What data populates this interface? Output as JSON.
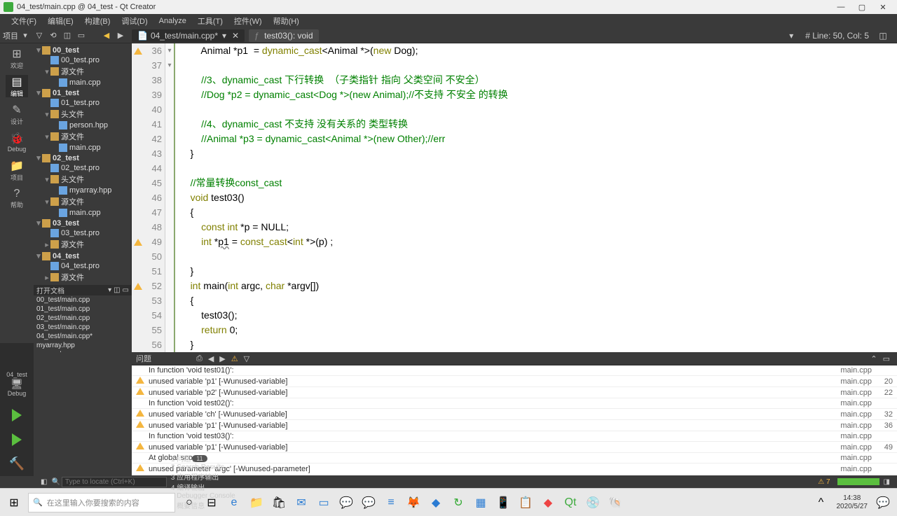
{
  "window": {
    "title": "04_test/main.cpp @ 04_test - Qt Creator"
  },
  "menu": [
    "文件(F)",
    "编辑(E)",
    "构建(B)",
    "调试(D)",
    "Analyze",
    "工具(T)",
    "控件(W)",
    "帮助(H)"
  ],
  "toolbar": {
    "project_label": "项目",
    "file_tab": "04_test/main.cpp*",
    "breadcrumb": "test03(): void",
    "cursor": "# Line: 50, Col: 5"
  },
  "sidebar": [
    {
      "label": "欢迎",
      "g": "⊞"
    },
    {
      "label": "编辑",
      "g": "▤",
      "active": true
    },
    {
      "label": "设计",
      "g": "✎"
    },
    {
      "label": "Debug",
      "g": "🐞"
    },
    {
      "label": "项目",
      "g": "📁"
    },
    {
      "label": "帮助",
      "g": "?"
    }
  ],
  "run": {
    "target": "04_test",
    "mode": "Debug"
  },
  "tree": [
    {
      "d": 0,
      "t": "00_test",
      "a": "▾",
      "f": "folder-ico",
      "b": true
    },
    {
      "d": 1,
      "t": "00_test.pro",
      "a": "",
      "f": "cpp-ico"
    },
    {
      "d": 1,
      "t": "源文件",
      "a": "▾",
      "f": "folder-ico"
    },
    {
      "d": 2,
      "t": "main.cpp",
      "a": "",
      "f": "cpp-ico"
    },
    {
      "d": 0,
      "t": "01_test",
      "a": "▾",
      "f": "folder-ico",
      "b": true
    },
    {
      "d": 1,
      "t": "01_test.pro",
      "a": "",
      "f": "cpp-ico"
    },
    {
      "d": 1,
      "t": "头文件",
      "a": "▾",
      "f": "folder-ico"
    },
    {
      "d": 2,
      "t": "person.hpp",
      "a": "",
      "f": "cpp-ico"
    },
    {
      "d": 1,
      "t": "源文件",
      "a": "▾",
      "f": "folder-ico"
    },
    {
      "d": 2,
      "t": "main.cpp",
      "a": "",
      "f": "cpp-ico"
    },
    {
      "d": 0,
      "t": "02_test",
      "a": "▾",
      "f": "folder-ico",
      "b": true
    },
    {
      "d": 1,
      "t": "02_test.pro",
      "a": "",
      "f": "cpp-ico"
    },
    {
      "d": 1,
      "t": "头文件",
      "a": "▾",
      "f": "folder-ico"
    },
    {
      "d": 2,
      "t": "myarray.hpp",
      "a": "",
      "f": "cpp-ico"
    },
    {
      "d": 1,
      "t": "源文件",
      "a": "▾",
      "f": "folder-ico"
    },
    {
      "d": 2,
      "t": "main.cpp",
      "a": "",
      "f": "cpp-ico"
    },
    {
      "d": 0,
      "t": "03_test",
      "a": "▾",
      "f": "folder-ico",
      "b": true
    },
    {
      "d": 1,
      "t": "03_test.pro",
      "a": "",
      "f": "cpp-ico"
    },
    {
      "d": 1,
      "t": "源文件",
      "a": "▸",
      "f": "folder-ico"
    },
    {
      "d": 0,
      "t": "04_test",
      "a": "▾",
      "f": "folder-ico",
      "b": true
    },
    {
      "d": 1,
      "t": "04_test.pro",
      "a": "",
      "f": "cpp-ico"
    },
    {
      "d": 1,
      "t": "源文件",
      "a": "▸",
      "f": "folder-ico"
    }
  ],
  "open_docs_header": "打开文档",
  "open_docs": [
    "00_test/main.cpp",
    "01_test/main.cpp",
    "02_test/main.cpp",
    "03_test/main.cpp",
    "04_test/main.cpp*",
    "myarray.hpp",
    "person.hpp"
  ],
  "code": {
    "first_line": 36,
    "lines": [
      {
        "n": 36,
        "warn": true,
        "html": "        Animal *p1  = <span class='kw'>dynamic_cast</span>&lt;Animal *&gt;(<span class='kw'>new</span> Dog);"
      },
      {
        "n": 37,
        "html": ""
      },
      {
        "n": 38,
        "html": "        <span class='comment'>//3、dynamic_cast 下行转换  （子类指针 指向 父类空间 不安全）</span>"
      },
      {
        "n": 39,
        "html": "        <span class='comment'>//Dog *p2 = dynamic_cast&lt;Dog *&gt;(new Animal);//不支持 不安全 的转换</span>"
      },
      {
        "n": 40,
        "html": ""
      },
      {
        "n": 41,
        "html": "        <span class='comment'>//4、dynamic_cast 不支持 没有关系的 类型转换</span>"
      },
      {
        "n": 42,
        "html": "        <span class='comment'>//Animal *p3 = dynamic_cast&lt;Animal *&gt;(new Other);//err</span>"
      },
      {
        "n": 43,
        "html": "    }"
      },
      {
        "n": 44,
        "html": ""
      },
      {
        "n": 45,
        "html": "    <span class='comment'>//常量转换const_cast</span>"
      },
      {
        "n": 46,
        "fold": "▾",
        "html": "    <span class='kw'>void</span> test03()"
      },
      {
        "n": 47,
        "html": "    {"
      },
      {
        "n": 48,
        "html": "        <span class='kw'>const</span> <span class='kw'>int</span> *p = NULL;"
      },
      {
        "n": 49,
        "warn": true,
        "html": "        <span class='kw'>int</span> *<span class='underline'>p1</span> = <span class='kw'>const_cast</span>&lt;<span class='kw'>int</span> *&gt;(p) ;"
      },
      {
        "n": 50,
        "html": "        "
      },
      {
        "n": 51,
        "html": "    }"
      },
      {
        "n": 52,
        "warn": true,
        "fold": "▾",
        "html": "    <span class='kw'>int</span> main(<span class='kw'>int</span> argc, <span class='kw'>char</span> *argv[])"
      },
      {
        "n": 53,
        "html": "    {"
      },
      {
        "n": 54,
        "html": "        test03();"
      },
      {
        "n": 55,
        "html": "        <span class='kw'>return</span> 0;"
      },
      {
        "n": 56,
        "html": "    }"
      }
    ]
  },
  "issues_header": "问题",
  "issues": [
    {
      "msg": "In function 'void test01()':",
      "file": "main.cpp",
      "line": ""
    },
    {
      "warn": true,
      "msg": "unused variable 'p1' [-Wunused-variable]",
      "file": "main.cpp",
      "line": "20"
    },
    {
      "warn": true,
      "msg": "unused variable 'p2' [-Wunused-variable]",
      "file": "main.cpp",
      "line": "22"
    },
    {
      "msg": "In function 'void test02()':",
      "file": "main.cpp",
      "line": ""
    },
    {
      "warn": true,
      "msg": "unused variable 'ch' [-Wunused-variable]",
      "file": "main.cpp",
      "line": "32"
    },
    {
      "warn": true,
      "msg": "unused variable 'p1' [-Wunused-variable]",
      "file": "main.cpp",
      "line": "36"
    },
    {
      "msg": "In function 'void test03()':",
      "file": "main.cpp",
      "line": ""
    },
    {
      "warn": true,
      "msg": "unused variable 'p1' [-Wunused-variable]",
      "file": "main.cpp",
      "line": "49"
    },
    {
      "msg": "At global scope:",
      "file": "main.cpp",
      "line": ""
    },
    {
      "warn": true,
      "msg": "unused parameter 'argc' [-Wunused-parameter]",
      "file": "main.cpp",
      "line": ""
    }
  ],
  "status": {
    "locator_ph": "Type to locate (Ctrl+K)",
    "items": [
      "1 问题",
      "2 Search Results",
      "3 应用程序输出",
      "4 编译输出",
      "5 Debugger Console",
      "6 概要信息"
    ],
    "issue_badge": "11",
    "warn_count": "⚠ 7"
  },
  "taskbar": {
    "search_ph": "在这里输入你要搜索的内容",
    "time": "14:38",
    "date": "2020/5/27"
  }
}
